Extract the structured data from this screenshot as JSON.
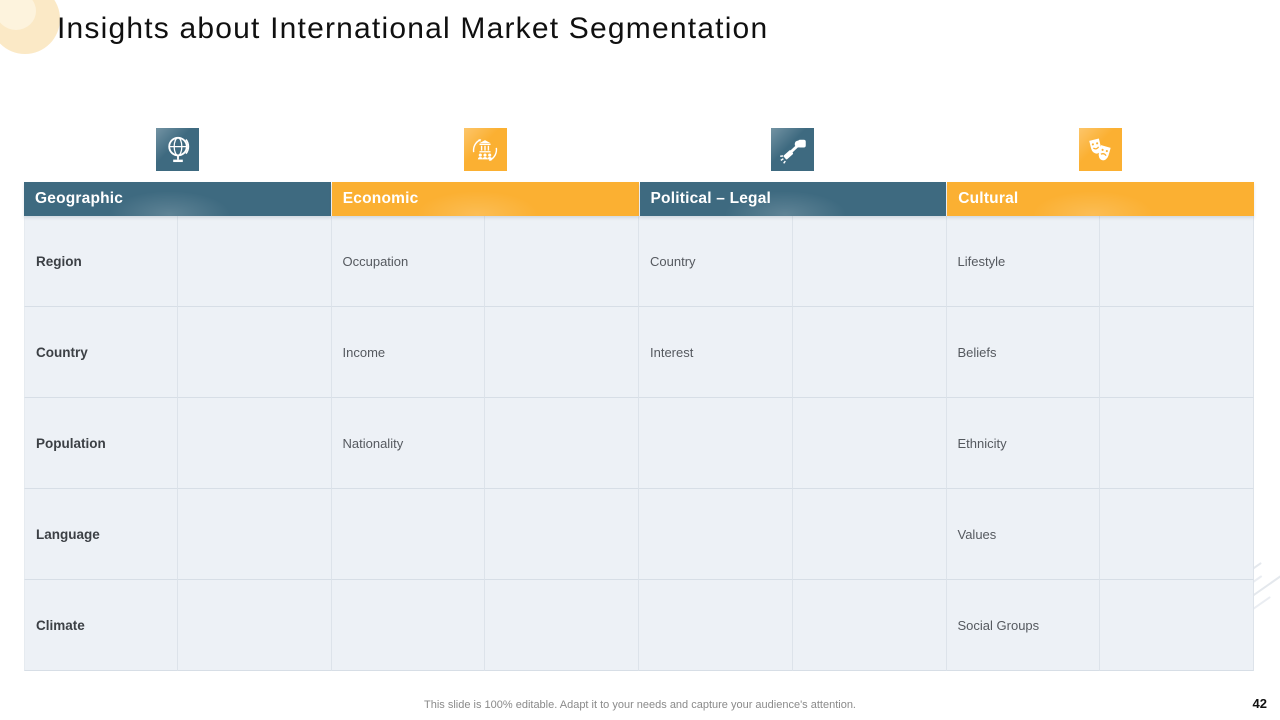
{
  "title": "Insights about International Market Segmentation",
  "footer": {
    "note": "This slide is 100% editable. Adapt it to your needs and capture your audience's attention.",
    "page_number": "42"
  },
  "colors": {
    "teal": "#3e6a80",
    "orange": "#fbb032",
    "cell_bg": "#edf1f6",
    "corner_blob": "#fbe9c6"
  },
  "table": {
    "segments": [
      {
        "label": "Geographic",
        "color": "#3e6a80",
        "icon": "globe-icon"
      },
      {
        "label": "Economic",
        "color": "#fbb032",
        "icon": "bank-economy-icon"
      },
      {
        "label": "Political – Legal",
        "color": "#3e6a80",
        "icon": "gavel-icon"
      },
      {
        "label": "Cultural",
        "color": "#fbb032",
        "icon": "theater-masks-icon"
      }
    ],
    "rows": [
      {
        "cells": [
          "Region",
          "",
          "Occupation",
          "",
          "Country",
          "",
          "Lifestyle",
          ""
        ]
      },
      {
        "cells": [
          "Country",
          "",
          "Income",
          "",
          "Interest",
          "",
          "Beliefs",
          ""
        ]
      },
      {
        "cells": [
          "Population",
          "",
          "Nationality",
          "",
          "",
          "",
          "Ethnicity",
          ""
        ]
      },
      {
        "cells": [
          "Language",
          "",
          "",
          "",
          "",
          "",
          "Values",
          ""
        ]
      },
      {
        "cells": [
          "Climate",
          "",
          "",
          "",
          "",
          "",
          "Social Groups",
          ""
        ]
      }
    ]
  }
}
